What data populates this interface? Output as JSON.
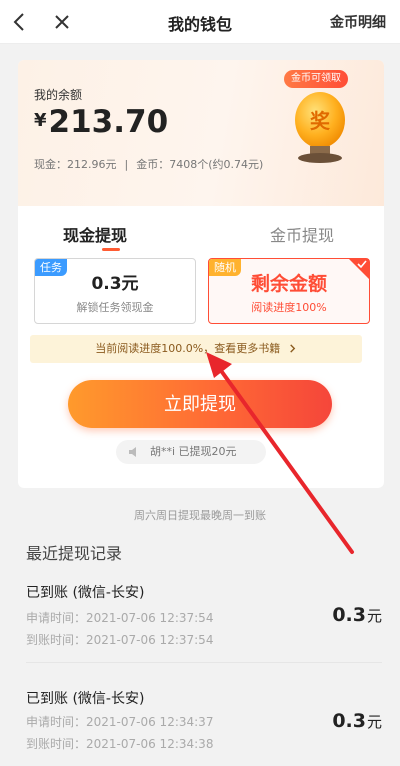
{
  "header": {
    "title": "我的钱包",
    "right_link": "金币明细"
  },
  "balance": {
    "label": "我的余额",
    "currency": "¥",
    "amount": "213.70",
    "cash_text": "现金：212.96元",
    "separator": "|",
    "coin_text": "金币：7408个(约0.74元)",
    "badge": "金币可领取",
    "trophy_char": "奖"
  },
  "tabs": {
    "cash": "现金提现",
    "coin": "金币提现"
  },
  "options": {
    "task": {
      "tag": "任务",
      "amount": "0.3元",
      "desc": "解锁任务领现金"
    },
    "random": {
      "tag": "随机",
      "amount": "剩余金额",
      "desc": "阅读进度100%"
    }
  },
  "progress_banner": "当前阅读进度100.0%，查看更多书籍",
  "withdraw_button": "立即提现",
  "ticker": "胡**i 已提现20元",
  "notice": "周六周日提现最晚周一到账",
  "records_title": "最近提现记录",
  "records": [
    {
      "status": "已到账 (微信-长安)",
      "apply_time": "申请时间：2021-07-06 12:37:54",
      "arrive_time": "到账时间：2021-07-06 12:37:54",
      "amount": "0.3",
      "unit": "元"
    },
    {
      "status": "已到账 (微信-长安)",
      "apply_time": "申请时间：2021-07-06 12:34:37",
      "arrive_time": "到账时间：2021-07-06 12:34:38",
      "amount": "0.3",
      "unit": "元"
    }
  ],
  "colors": {
    "accent": "#ff4d36",
    "button_start": "#ff9a2c",
    "button_end": "#f5463a",
    "task_tag": "#3b9bff",
    "random_tag": "#ffb22e"
  }
}
